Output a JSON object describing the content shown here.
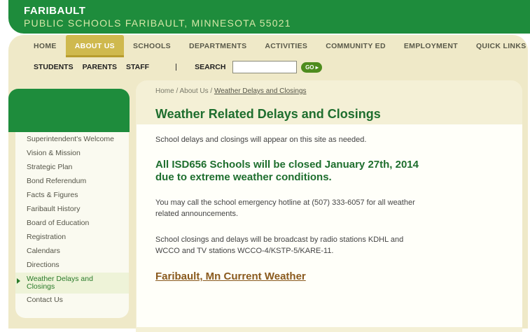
{
  "header": {
    "name": "FARIBAULT",
    "subtitle": "PUBLIC SCHOOLS FARIBAULT, MINNESOTA  55021"
  },
  "nav": {
    "items": [
      {
        "label": "HOME"
      },
      {
        "label": "ABOUT US"
      },
      {
        "label": "SCHOOLS"
      },
      {
        "label": "DEPARTMENTS"
      },
      {
        "label": "ACTIVITIES"
      },
      {
        "label": "COMMUNITY ED"
      },
      {
        "label": "EMPLOYMENT"
      },
      {
        "label": "QUICK LINKS"
      }
    ],
    "active": "ABOUT US"
  },
  "subnav": {
    "links": [
      "STUDENTS",
      "PARENTS",
      "STAFF"
    ],
    "separator": "|",
    "search_label": "SEARCH",
    "search_value": "",
    "go_label": "GO ▸"
  },
  "sidebar": {
    "items": [
      "Superintendent's Welcome",
      "Vision & Mission",
      "Strategic Plan",
      "Bond Referendum",
      "Facts & Figures",
      "Faribault History",
      "Board of Education",
      "Registration",
      "Calendars",
      "Directions",
      "Weather Delays and Closings",
      "Contact Us"
    ],
    "active_label_line1": "Weather Delays and",
    "active_label_line2": "Closings"
  },
  "breadcrumb": {
    "home": "Home",
    "about": "About Us",
    "sep": " / ",
    "current": "Weather Delays and Closings"
  },
  "content": {
    "title": "Weather Related Delays and Closings",
    "intro": "School delays and closings will appear on this site as needed.",
    "alert_line1": "All ISD656 Schools will be closed January 27th, 2014",
    "alert_line2": "due to extreme weather conditions.",
    "hotline_line1": "You may call the school emergency hotline at (507) 333-6057 for all weather",
    "hotline_line2": "related announcements.",
    "broadcast_line1": "School closings and delays will be broadcast by radio stations KDHL and",
    "broadcast_line2": "WCCO and TV stations WCCO-4/KSTP-5/KARE-11.",
    "weather_link": "Faribault, Mn Current Weather"
  },
  "colors": {
    "brand_green": "#1e8c3c",
    "accent_gold": "#cfb94e",
    "link_brown": "#8a5a1e"
  }
}
